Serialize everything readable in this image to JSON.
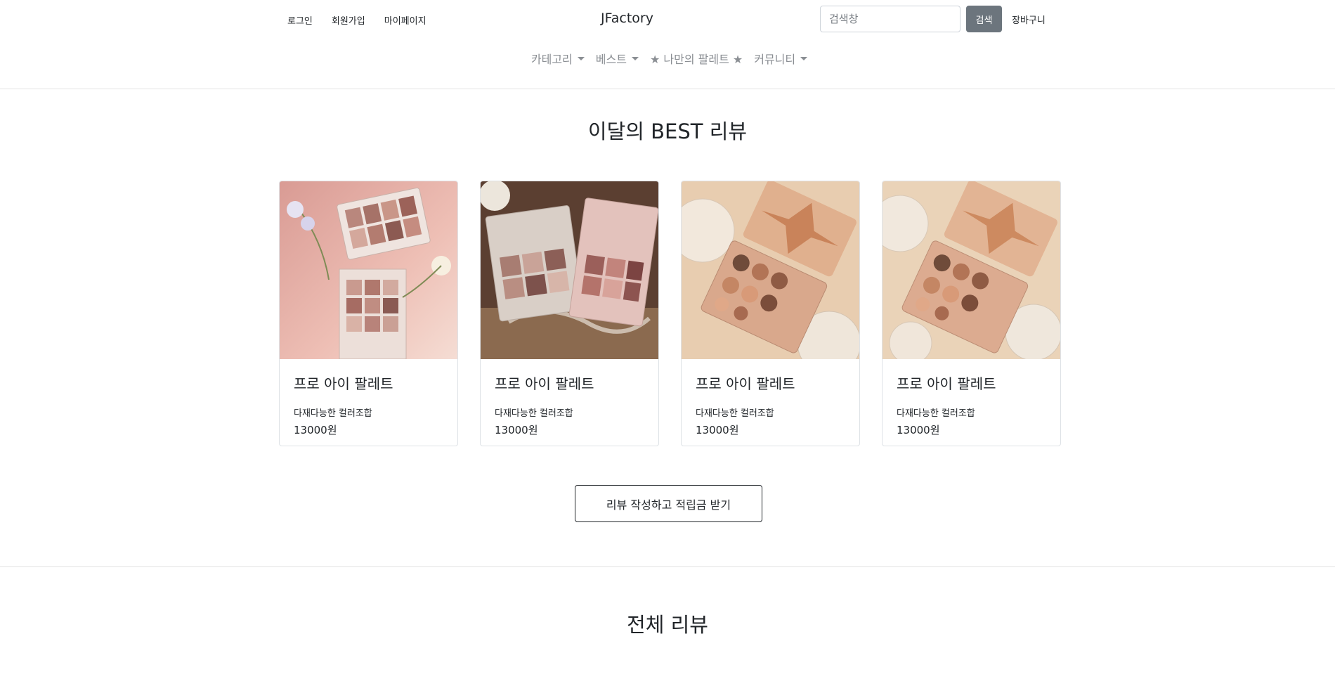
{
  "header": {
    "links": {
      "login": "로그인",
      "signup": "회원가입",
      "mypage": "마이페이지"
    },
    "brand": "JFactory",
    "search": {
      "placeholder": "검색창",
      "value": "",
      "button": "검색"
    },
    "cart": "장바구니"
  },
  "nav": {
    "items": [
      {
        "label": "카테고리",
        "dropdown": true
      },
      {
        "label": "베스트",
        "dropdown": true
      },
      {
        "label": "★ 나만의 팔레트 ★",
        "dropdown": false
      },
      {
        "label": "커뮤니티",
        "dropdown": true
      }
    ]
  },
  "best": {
    "title": "이달의 BEST 리뷰",
    "cards": [
      {
        "title": "프로 아이 팔레트",
        "desc": "다재다능한 컬러조합",
        "price": "13000원",
        "image": "eyeshadow-palette-pink-flowers"
      },
      {
        "title": "프로 아이 팔레트",
        "desc": "다재다능한 컬러조합",
        "price": "13000원",
        "image": "eyeshadow-palettes-on-lace"
      },
      {
        "title": "프로 아이 팔레트",
        "desc": "다재다능한 컬러조합",
        "price": "13000원",
        "image": "gem-palette-gold"
      },
      {
        "title": "프로 아이 팔레트",
        "desc": "다재다능한 컬러조합",
        "price": "13000원",
        "image": "gem-palette-gold-crystal"
      }
    ],
    "cta": "리뷰 작성하고 적립금 받기"
  },
  "all_reviews": {
    "title": "전체 리뷰"
  },
  "colors": {
    "secondary_button": "#6c757d",
    "nav_text": "#8a8e93",
    "border": "#dee2e6"
  }
}
